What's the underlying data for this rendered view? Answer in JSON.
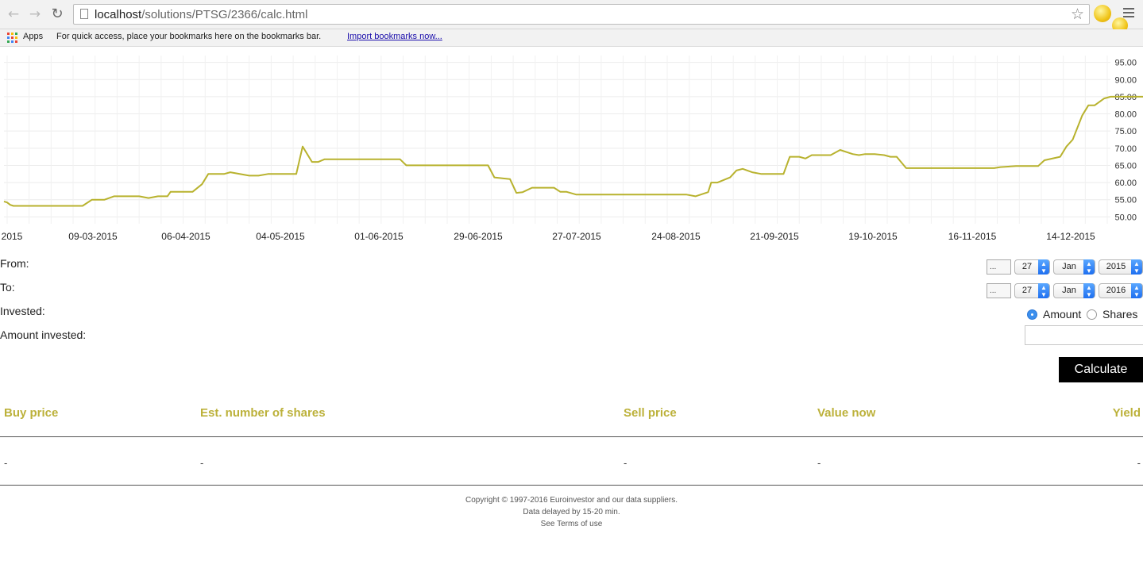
{
  "browser": {
    "url_host": "localhost",
    "url_path": "/solutions/PTSG/2366/calc.html",
    "apps_label": "Apps",
    "bookmarks_hint": "For quick access, place your bookmarks here on the bookmarks bar.",
    "import_link": "Import bookmarks now..."
  },
  "chart_data": {
    "type": "line",
    "title": "",
    "xlabel": "",
    "ylabel": "",
    "color": "#b8b22e",
    "ylim": [
      48,
      97
    ],
    "y_ticks": [
      "95.00",
      "90.00",
      "85.00",
      "80.00",
      "75.00",
      "70.00",
      "65.00",
      "60.00",
      "55.00",
      "50.00"
    ],
    "x_ticks": [
      "2015",
      "09-03-2015",
      "06-04-2015",
      "04-05-2015",
      "01-06-2015",
      "29-06-2015",
      "27-07-2015",
      "24-08-2015",
      "21-09-2015",
      "19-10-2015",
      "16-11-2015",
      "14-12-2015"
    ],
    "x_start": "2015-02-09",
    "x_end": "2016-01-27",
    "series": [
      {
        "name": "",
        "points": [
          [
            "2015-02-09",
            54.5
          ],
          [
            "2015-02-10",
            54.2
          ],
          [
            "2015-02-11",
            53.5
          ],
          [
            "2015-02-12",
            53.2
          ],
          [
            "2015-03-06",
            53.2
          ],
          [
            "2015-03-09",
            55.0
          ],
          [
            "2015-03-13",
            55.0
          ],
          [
            "2015-03-16",
            56.0
          ],
          [
            "2015-03-24",
            56.0
          ],
          [
            "2015-03-27",
            55.5
          ],
          [
            "2015-03-30",
            56.0
          ],
          [
            "2015-04-02",
            56.0
          ],
          [
            "2015-04-03",
            57.3
          ],
          [
            "2015-04-10",
            57.3
          ],
          [
            "2015-04-13",
            59.5
          ],
          [
            "2015-04-15",
            62.5
          ],
          [
            "2015-04-20",
            62.5
          ],
          [
            "2015-04-22",
            63.0
          ],
          [
            "2015-04-28",
            62.0
          ],
          [
            "2015-05-01",
            62.0
          ],
          [
            "2015-05-04",
            62.5
          ],
          [
            "2015-05-13",
            62.5
          ],
          [
            "2015-05-15",
            70.5
          ],
          [
            "2015-05-18",
            66.0
          ],
          [
            "2015-05-20",
            66.0
          ],
          [
            "2015-05-22",
            66.8
          ],
          [
            "2015-06-15",
            66.8
          ],
          [
            "2015-06-17",
            65.0
          ],
          [
            "2015-07-13",
            65.0
          ],
          [
            "2015-07-15",
            61.5
          ],
          [
            "2015-07-20",
            61.0
          ],
          [
            "2015-07-22",
            57.0
          ],
          [
            "2015-07-24",
            57.2
          ],
          [
            "2015-07-27",
            58.5
          ],
          [
            "2015-08-03",
            58.5
          ],
          [
            "2015-08-05",
            57.3
          ],
          [
            "2015-08-07",
            57.3
          ],
          [
            "2015-08-10",
            56.5
          ],
          [
            "2015-08-26",
            56.5
          ],
          [
            "2015-09-09",
            56.5
          ],
          [
            "2015-09-14",
            56.5
          ],
          [
            "2015-09-17",
            56.0
          ],
          [
            "2015-09-21",
            57.2
          ],
          [
            "2015-09-22",
            60.0
          ],
          [
            "2015-09-24",
            60.0
          ],
          [
            "2015-09-28",
            61.5
          ],
          [
            "2015-09-30",
            63.5
          ],
          [
            "2015-10-02",
            64.0
          ],
          [
            "2015-10-05",
            63.0
          ],
          [
            "2015-10-08",
            62.5
          ],
          [
            "2015-10-15",
            62.5
          ],
          [
            "2015-10-17",
            67.5
          ],
          [
            "2015-10-20",
            67.5
          ],
          [
            "2015-10-22",
            67.0
          ],
          [
            "2015-10-24",
            68.0
          ],
          [
            "2015-10-30",
            68.0
          ],
          [
            "2015-11-02",
            69.5
          ],
          [
            "2015-11-06",
            68.3
          ],
          [
            "2015-11-08",
            68.0
          ],
          [
            "2015-11-10",
            68.3
          ],
          [
            "2015-11-13",
            68.3
          ],
          [
            "2015-11-16",
            68.0
          ],
          [
            "2015-11-18",
            67.5
          ],
          [
            "2015-11-20",
            67.5
          ],
          [
            "2015-11-23",
            64.2
          ],
          [
            "2015-12-21",
            64.2
          ],
          [
            "2015-12-23",
            64.5
          ],
          [
            "2015-12-28",
            64.8
          ],
          [
            "2016-01-04",
            64.8
          ],
          [
            "2016-01-06",
            66.5
          ],
          [
            "2016-01-11",
            67.5
          ],
          [
            "2016-01-13",
            70.5
          ],
          [
            "2016-01-15",
            72.5
          ],
          [
            "2016-01-18",
            79.5
          ],
          [
            "2016-01-20",
            82.5
          ],
          [
            "2016-01-22",
            82.5
          ],
          [
            "2016-01-25",
            84.5
          ],
          [
            "2016-01-27",
            85.0
          ]
        ]
      }
    ]
  },
  "form": {
    "from_label": "From:",
    "to_label": "To:",
    "invested_label": "Invested:",
    "amount_label": "Amount invested:",
    "date_img_alt": "...",
    "from": {
      "day": "27",
      "month": "Jan",
      "year": "2015"
    },
    "to": {
      "day": "27",
      "month": "Jan",
      "year": "2016"
    },
    "option_amount": "Amount",
    "option_shares": "Shares",
    "selected_option": "Amount",
    "amount_value": "",
    "calculate_label": "Calculate"
  },
  "results": {
    "headers": [
      "Buy price",
      "Est. number of shares",
      "Sell price",
      "Value now",
      "Yield"
    ],
    "values": [
      "-",
      "-",
      "-",
      "-",
      "-"
    ]
  },
  "footer": {
    "line1": "Copyright © 1997-2016 Euroinvestor and our data suppliers.",
    "line2": "Data delayed by 15-20 min.",
    "line3": "See Terms of use"
  }
}
